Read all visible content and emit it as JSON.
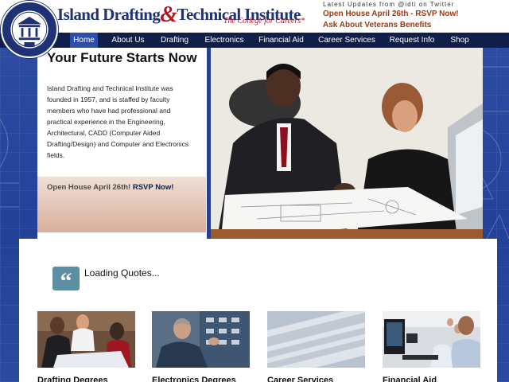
{
  "header": {
    "brand_name_part1": "Island Drafting",
    "brand_amp": "&",
    "brand_name_part2": "Technical Institute",
    "tagline": "The College for Careers*",
    "updates_title": "Latest Updates from @idti on Twitter",
    "updates": [
      "Open House April 26th - RSVP Now!",
      "Ask About Veterans Benefits"
    ]
  },
  "nav": {
    "items": [
      "Home",
      "About Us",
      "Drafting",
      "Electronics",
      "Financial Aid",
      "Career Services",
      "Request Info",
      "Shop"
    ],
    "active": "Home"
  },
  "hero": {
    "title": "Your Future Starts Now",
    "body": "Island Drafting and Technical Institute was founded in 1957, and is staffed by faculty members who have had professional and practical experience in the Engineering, Architectural, CADD (Computer Aided Drafting/Design) and Computer and Electronics fields.",
    "cta_text": "Open House April 26th!",
    "cta_link": "RSVP Now!"
  },
  "quotes": {
    "icon": "quote-icon",
    "text": "Loading Quotes..."
  },
  "cards": [
    {
      "label": "Drafting Degrees"
    },
    {
      "label": "Electronics Degrees"
    },
    {
      "label": "Career Services"
    },
    {
      "label": "Financial Aid"
    }
  ],
  "colors": {
    "navy": "#101e4a",
    "brand_blue": "#1f3274",
    "brand_red": "#b2131f",
    "update_orange": "#a3380e",
    "nav_active": "#2d4ea8",
    "background_blue": "#27408b",
    "quote_teal": "#5a8fa4"
  }
}
